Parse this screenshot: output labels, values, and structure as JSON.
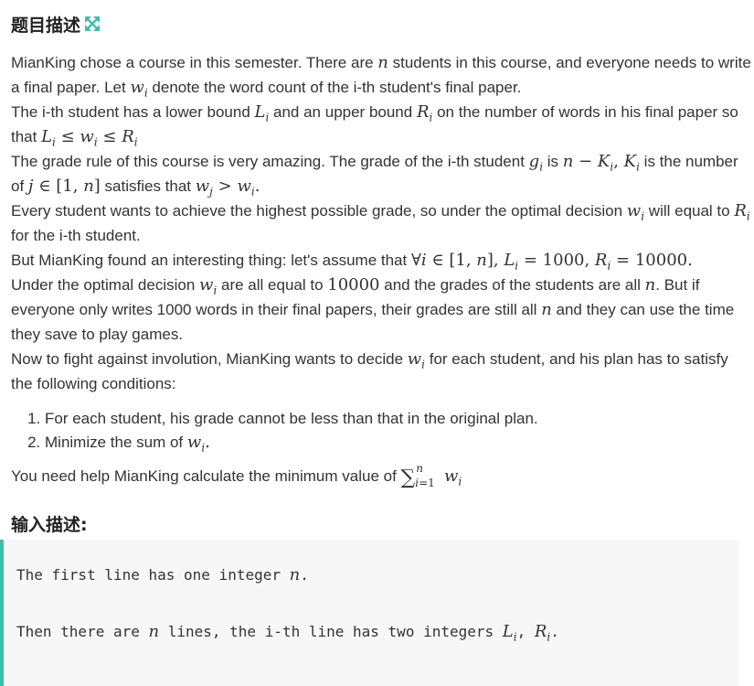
{
  "problem_section": {
    "title": "题目描述",
    "expand_icon": "expand-arrows-icon",
    "accent_color": "#3bbfad"
  },
  "description": {
    "p1_a": "MianKing chose a course in this semester. There are ",
    "p1_b": " students in this course, and everyone needs to write a final paper. Let ",
    "p1_c": " denote the word count of the i-th student's final paper.",
    "p2_a": "The i-th student has a lower bound ",
    "p2_b": " and an upper bound ",
    "p2_c": " on the number of words in his final paper so that ",
    "p3_a": "The grade rule of this course is very amazing. The grade of the i-th student ",
    "p3_b": " is ",
    "p3_c": " is the number of ",
    "p3_d": " satisfies that ",
    "p4_a": "Every student wants to achieve the highest possible grade, so under the optimal decision ",
    "p4_b": " will equal to ",
    "p4_c": " for the i-th student.",
    "p5_a": "But MianKing found an interesting thing: let's assume that ",
    "p6_a": "Under the optimal decision ",
    "p6_b": " are all equal to ",
    "p6_c": " and the grades of the students are all ",
    "p6_d": ". But if everyone only writes 1000 words in their final papers, their grades are still all ",
    "p6_e": " and they can use the time they save to play games.",
    "p7_a": "Now to fight against involution, MianKing wants to decide ",
    "p7_b": " for each student, and his plan has to satisfy the following conditions:",
    "cond1": "For each student, his grade cannot be less than that in the original plan.",
    "cond2_a": "Minimize the sum of ",
    "p8_a": "You need help MianKing calculate the minimum value of "
  },
  "input_section": {
    "title": "输入描述:",
    "line1_a": "The first line has one integer ",
    "line2_a": "Then there are ",
    "line2_b": " lines, the i-th line has two integers "
  }
}
